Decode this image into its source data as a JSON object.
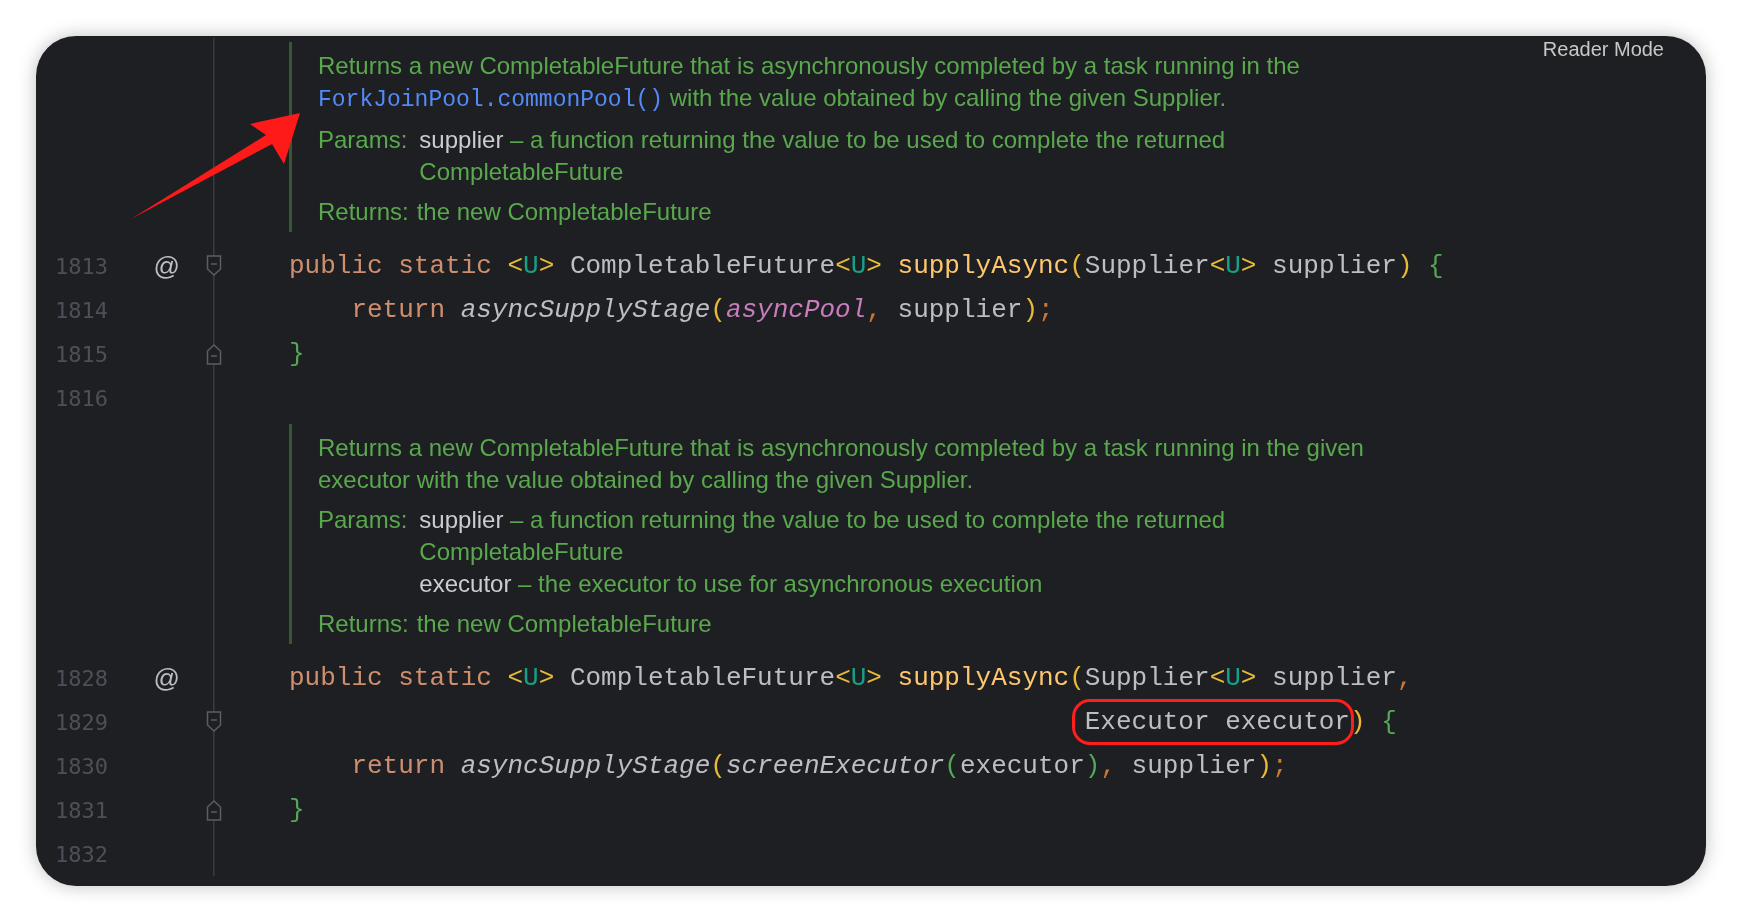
{
  "reader_mode": "Reader Mode",
  "blocks": [
    {
      "kind": "doc",
      "description": [
        [
          {
            "kind": "text",
            "text": "Returns a new CompletableFuture that is asynchronously completed by a task running in the"
          }
        ],
        [
          {
            "kind": "link",
            "text": "ForkJoinPool.commonPool()"
          },
          {
            "kind": "text",
            "text": " with the value obtained by calling the given Supplier."
          }
        ]
      ],
      "params_label": "Params:",
      "params": [
        {
          "name": "supplier",
          "lines": [
            "– a function returning the value to be used to complete the returned",
            "CompletableFuture"
          ]
        }
      ],
      "returns_label": "Returns:",
      "returns": "the new CompletableFuture"
    },
    {
      "kind": "line",
      "number": "1813",
      "gutter_mark": "@",
      "fold_start": true,
      "tokens": [
        {
          "kind": "keyword",
          "text": "public static "
        },
        {
          "kind": "bracket",
          "text": "<"
        },
        {
          "kind": "typeparam",
          "text": "U"
        },
        {
          "kind": "bracket",
          "text": "> "
        },
        {
          "kind": "plain",
          "text": "CompletableFuture"
        },
        {
          "kind": "bracket",
          "text": "<"
        },
        {
          "kind": "typeparam",
          "text": "U"
        },
        {
          "kind": "bracket",
          "text": "> "
        },
        {
          "kind": "method",
          "text": "supplyAsync"
        },
        {
          "kind": "bracket",
          "text": "("
        },
        {
          "kind": "plain",
          "text": "Supplier"
        },
        {
          "kind": "bracket",
          "text": "<"
        },
        {
          "kind": "typeparam",
          "text": "U"
        },
        {
          "kind": "bracket",
          "text": "> "
        },
        {
          "kind": "plain",
          "text": "supplier"
        },
        {
          "kind": "bracket",
          "text": ")"
        },
        {
          "kind": "brace",
          "text": " {"
        }
      ]
    },
    {
      "kind": "line",
      "number": "1814",
      "tokens": [
        {
          "kind": "keyword",
          "text": "    return "
        },
        {
          "kind": "call",
          "text": "asyncSupplyStage"
        },
        {
          "kind": "bracket",
          "text": "("
        },
        {
          "kind": "field",
          "text": "asyncPool"
        },
        {
          "kind": "punct",
          "text": ", "
        },
        {
          "kind": "plain",
          "text": "supplier"
        },
        {
          "kind": "bracket",
          "text": ")"
        },
        {
          "kind": "punct",
          "text": ";"
        }
      ]
    },
    {
      "kind": "line",
      "number": "1815",
      "fold_end": true,
      "tokens": [
        {
          "kind": "brace",
          "text": "}"
        }
      ]
    },
    {
      "kind": "line",
      "number": "1816"
    },
    {
      "kind": "doc",
      "description": [
        [
          {
            "kind": "text",
            "text": "Returns a new CompletableFuture that is asynchronously completed by a task running in the given"
          }
        ],
        [
          {
            "kind": "text",
            "text": "executor with the value obtained by calling the given Supplier."
          }
        ]
      ],
      "params_label": "Params:",
      "params": [
        {
          "name": "supplier",
          "lines": [
            "– a function returning the value to be used to complete the returned",
            "CompletableFuture"
          ]
        },
        {
          "name": "executor",
          "lines": [
            "– the executor to use for asynchronous execution"
          ]
        }
      ],
      "returns_label": "Returns:",
      "returns": "the new CompletableFuture"
    },
    {
      "kind": "line",
      "number": "1828",
      "gutter_mark": "@",
      "tokens": [
        {
          "kind": "keyword",
          "text": "public static "
        },
        {
          "kind": "bracket",
          "text": "<"
        },
        {
          "kind": "typeparam",
          "text": "U"
        },
        {
          "kind": "bracket",
          "text": "> "
        },
        {
          "kind": "plain",
          "text": "CompletableFuture"
        },
        {
          "kind": "bracket",
          "text": "<"
        },
        {
          "kind": "typeparam",
          "text": "U"
        },
        {
          "kind": "bracket",
          "text": "> "
        },
        {
          "kind": "method",
          "text": "supplyAsync"
        },
        {
          "kind": "bracket",
          "text": "("
        },
        {
          "kind": "plain",
          "text": "Supplier"
        },
        {
          "kind": "bracket",
          "text": "<"
        },
        {
          "kind": "typeparam",
          "text": "U"
        },
        {
          "kind": "bracket",
          "text": "> "
        },
        {
          "kind": "plain",
          "text": "supplier"
        },
        {
          "kind": "punct",
          "text": ","
        }
      ]
    },
    {
      "kind": "line",
      "number": "1829",
      "fold_start": true,
      "continuation": true,
      "tokens": [
        {
          "kind": "plain",
          "text": "Executor executor",
          "annotated": true
        },
        {
          "kind": "bracket",
          "text": ")"
        },
        {
          "kind": "brace",
          "text": " {"
        }
      ]
    },
    {
      "kind": "line",
      "number": "1830",
      "tokens": [
        {
          "kind": "keyword",
          "text": "    return "
        },
        {
          "kind": "call",
          "text": "asyncSupplyStage"
        },
        {
          "kind": "bracket",
          "text": "("
        },
        {
          "kind": "call",
          "text": "screenExecutor"
        },
        {
          "kind": "bracket2",
          "text": "("
        },
        {
          "kind": "plain",
          "text": "executor"
        },
        {
          "kind": "bracket2",
          "text": ")"
        },
        {
          "kind": "punct",
          "text": ", "
        },
        {
          "kind": "plain",
          "text": "supplier"
        },
        {
          "kind": "bracket",
          "text": ")"
        },
        {
          "kind": "punct",
          "text": ";"
        }
      ]
    },
    {
      "kind": "line",
      "number": "1831",
      "fold_end": true,
      "tokens": [
        {
          "kind": "brace",
          "text": "}"
        }
      ]
    },
    {
      "kind": "line",
      "number": "1832"
    }
  ]
}
